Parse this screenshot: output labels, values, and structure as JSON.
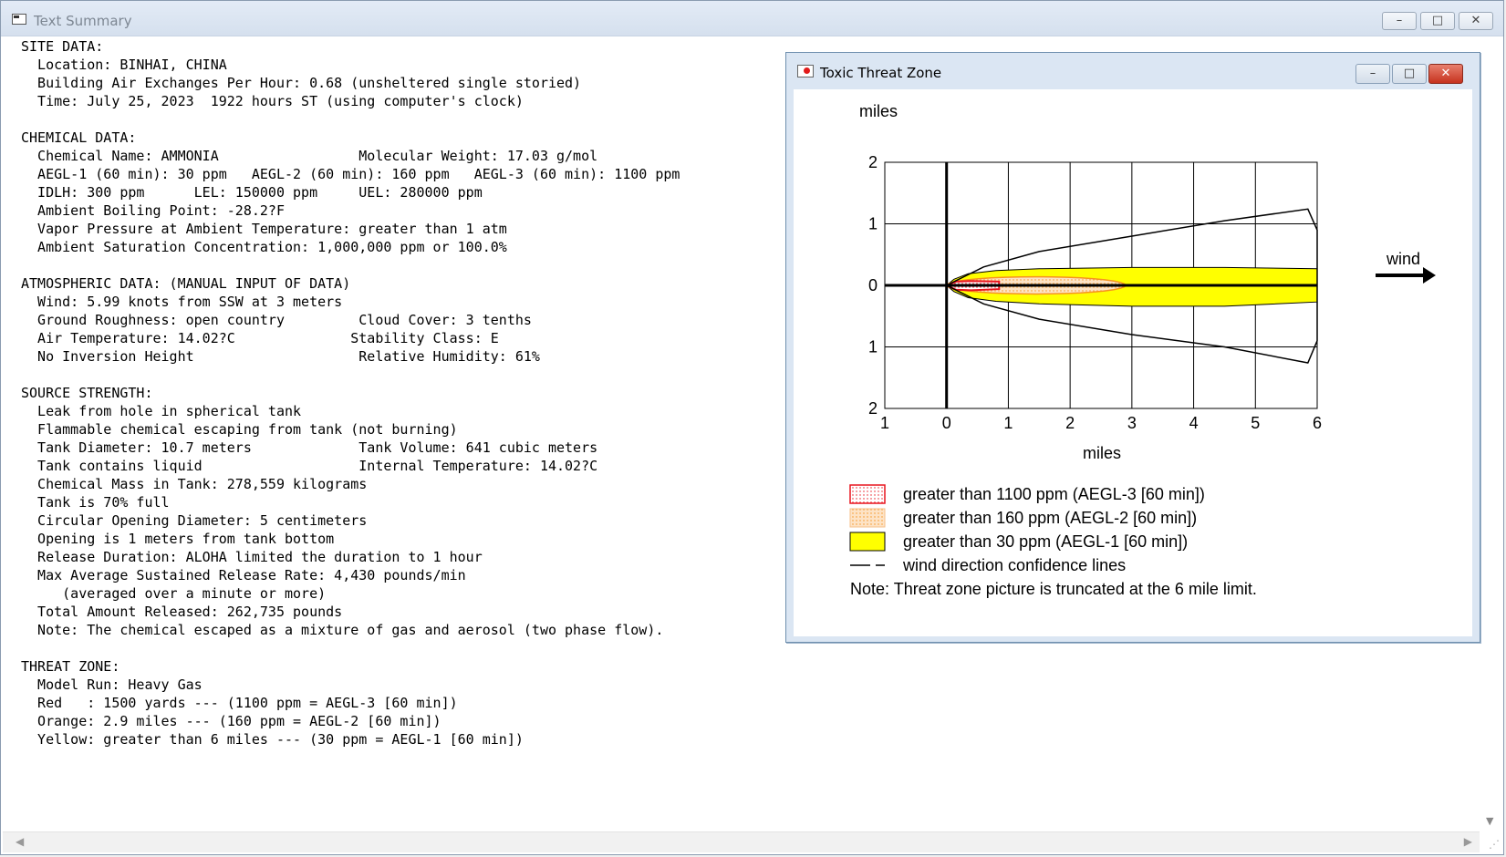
{
  "window": {
    "title": "Text Summary",
    "minimize_glyph": "–",
    "maximize_glyph": "□",
    "close_glyph": "✕"
  },
  "summary_text": "SITE DATA:\n  Location: BINHAI, CHINA\n  Building Air Exchanges Per Hour: 0.68 (unsheltered single storied)\n  Time: July 25, 2023  1922 hours ST (using computer's clock)\n\nCHEMICAL DATA:\n  Chemical Name: AMMONIA                 Molecular Weight: 17.03 g/mol\n  AEGL-1 (60 min): 30 ppm   AEGL-2 (60 min): 160 ppm   AEGL-3 (60 min): 1100 ppm\n  IDLH: 300 ppm      LEL: 150000 ppm     UEL: 280000 ppm\n  Ambient Boiling Point: -28.2?F\n  Vapor Pressure at Ambient Temperature: greater than 1 atm\n  Ambient Saturation Concentration: 1,000,000 ppm or 100.0%\n\nATMOSPHERIC DATA: (MANUAL INPUT OF DATA)\n  Wind: 5.99 knots from SSW at 3 meters\n  Ground Roughness: open country         Cloud Cover: 3 tenths\n  Air Temperature: 14.02?C              Stability Class: E\n  No Inversion Height                    Relative Humidity: 61%\n\nSOURCE STRENGTH:\n  Leak from hole in spherical tank\n  Flammable chemical escaping from tank (not burning)\n  Tank Diameter: 10.7 meters             Tank Volume: 641 cubic meters\n  Tank contains liquid                   Internal Temperature: 14.02?C\n  Chemical Mass in Tank: 278,559 kilograms\n  Tank is 70% full\n  Circular Opening Diameter: 5 centimeters\n  Opening is 1 meters from tank bottom\n  Release Duration: ALOHA limited the duration to 1 hour\n  Max Average Sustained Release Rate: 4,430 pounds/min\n     (averaged over a minute or more)\n  Total Amount Released: 262,735 pounds\n  Note: The chemical escaped as a mixture of gas and aerosol (two phase flow).\n\nTHREAT ZONE:\n  Model Run: Heavy Gas\n  Red   : 1500 yards --- (1100 ppm = AEGL-3 [60 min])\n  Orange: 2.9 miles --- (160 ppm = AEGL-2 [60 min])\n  Yellow: greater than 6 miles --- (30 ppm = AEGL-1 [60 min])",
  "threat_window": {
    "title": "Toxic Threat Zone",
    "y_unit": "miles",
    "x_unit": "miles",
    "x_ticks": [
      "1",
      "0",
      "1",
      "2",
      "3",
      "4",
      "5",
      "6"
    ],
    "y_ticks": [
      "2",
      "1",
      "0",
      "1",
      "2"
    ],
    "wind_label": "wind",
    "legend": [
      {
        "label": "greater than 1100 ppm (AEGL-3 [60 min])",
        "color": "#e8141e",
        "swatch": "red-dotted"
      },
      {
        "label": "greater than 160 ppm (AEGL-2 [60 min])",
        "color": "#f7931e",
        "swatch": "orange-dotted"
      },
      {
        "label": "greater than 30 ppm (AEGL-1 [60 min])",
        "color": "#ffff00",
        "swatch": "yellow-solid"
      },
      {
        "label": "wind direction confidence lines",
        "color": "#000000",
        "swatch": "dash-line"
      }
    ],
    "note": "Note: Threat zone picture is truncated at the 6 mile limit."
  },
  "zones": {
    "red_extent_miles": 0.85,
    "orange_extent_miles": 2.9,
    "yellow_extent_miles": 6
  }
}
